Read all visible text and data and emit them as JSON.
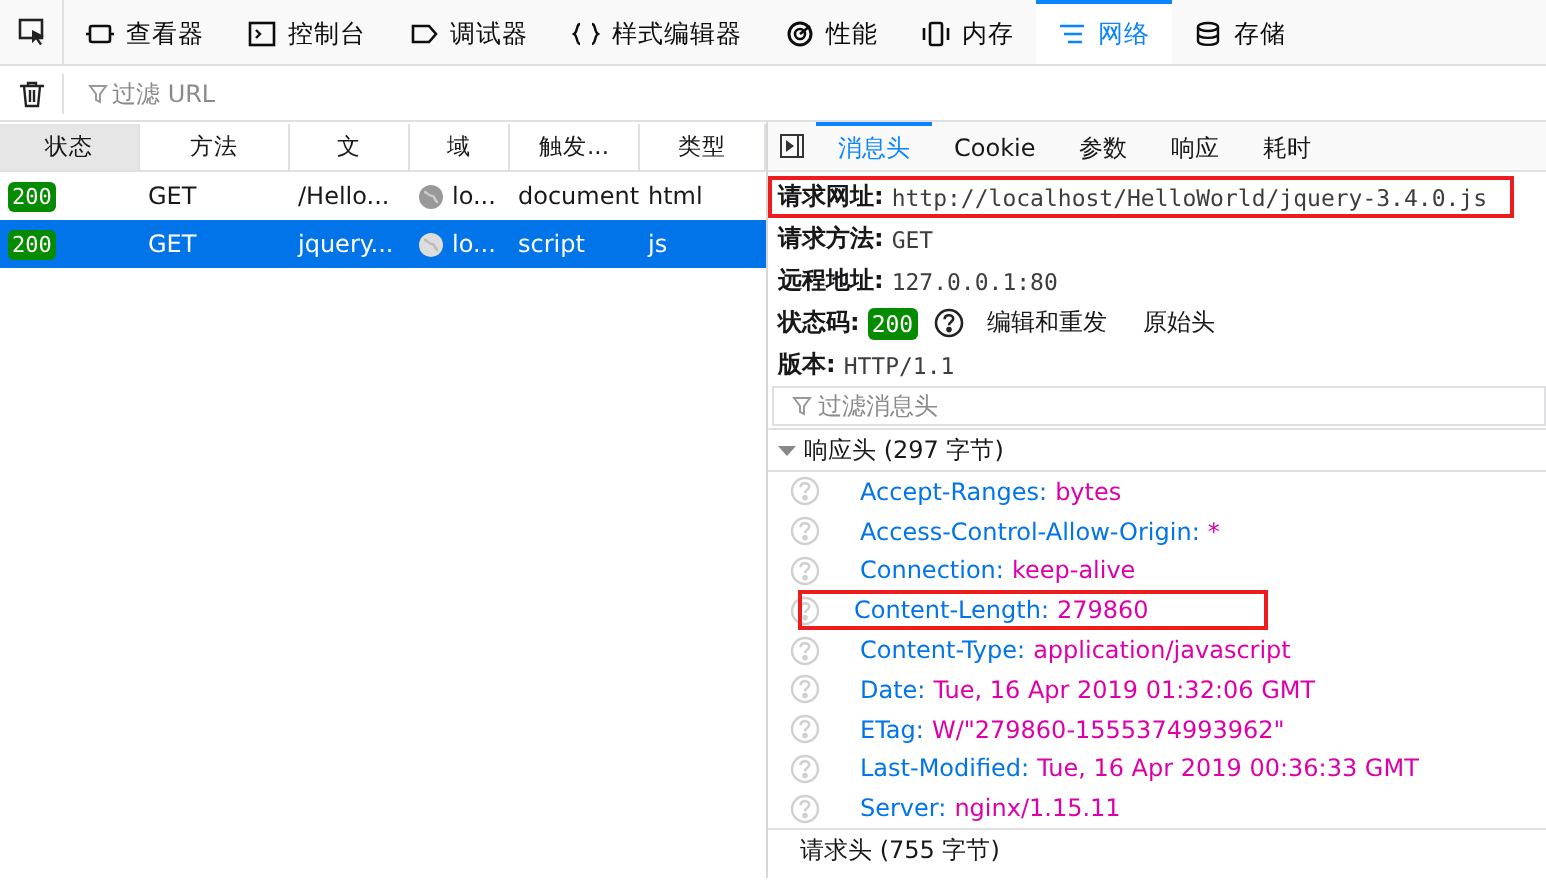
{
  "toolbar": {
    "tabs": [
      {
        "label": "查看器",
        "kind": "inspector",
        "selected": false
      },
      {
        "label": "控制台",
        "kind": "console",
        "selected": false
      },
      {
        "label": "调试器",
        "kind": "debugger",
        "selected": false
      },
      {
        "label": "样式编辑器",
        "kind": "style",
        "selected": false
      },
      {
        "label": "性能",
        "kind": "performance",
        "selected": false
      },
      {
        "label": "内存",
        "kind": "memory",
        "selected": false
      },
      {
        "label": "网络",
        "kind": "network",
        "selected": true
      },
      {
        "label": "存储",
        "kind": "storage",
        "selected": false
      }
    ]
  },
  "filter": {
    "placeholder": "过滤 URL"
  },
  "requests": {
    "columns": [
      {
        "label": "状态",
        "selected": true
      },
      {
        "label": "方法",
        "selected": false
      },
      {
        "label": "文",
        "selected": false
      },
      {
        "label": "域",
        "selected": false
      },
      {
        "label": "触发...",
        "selected": false
      },
      {
        "label": "类型",
        "selected": false
      }
    ],
    "rows": [
      {
        "status": "200",
        "method": "GET",
        "file": "/Hello...",
        "domain": "lo...",
        "cause": "document",
        "type": "html",
        "selected": false
      },
      {
        "status": "200",
        "method": "GET",
        "file": "jquery...",
        "domain": "lo...",
        "cause": "script",
        "type": "js",
        "selected": true
      }
    ]
  },
  "details": {
    "tabs": [
      {
        "label": "消息头",
        "selected": true
      },
      {
        "label": "Cookie",
        "selected": false
      },
      {
        "label": "参数",
        "selected": false
      },
      {
        "label": "响应",
        "selected": false
      },
      {
        "label": "耗时",
        "selected": false
      }
    ],
    "summary": [
      {
        "label": "请求网址:",
        "value": "http://localhost/HelloWorld/jquery-3.4.0.js",
        "highlighted": true
      },
      {
        "label": "请求方法:",
        "value": "GET",
        "highlighted": false
      },
      {
        "label": "远程地址:",
        "value": "127.0.0.1:80",
        "highlighted": false
      }
    ],
    "status": {
      "label": "状态码:",
      "badge": "200",
      "buttons": [
        "编辑和重发",
        "原始头"
      ]
    },
    "version": {
      "label": "版本:",
      "value": "HTTP/1.1"
    },
    "filter": {
      "placeholder": "过滤消息头"
    },
    "response_headers": {
      "title": "响应头 (297 字节)",
      "expanded": true,
      "headers": [
        {
          "name": "Accept-Ranges:",
          "value": "bytes",
          "highlighted": false
        },
        {
          "name": "Access-Control-Allow-Origin:",
          "value": "*",
          "highlighted": false
        },
        {
          "name": "Connection:",
          "value": "keep-alive",
          "highlighted": false
        },
        {
          "name": "Content-Length:",
          "value": "279860",
          "highlighted": true
        },
        {
          "name": "Content-Type:",
          "value": "application/javascript",
          "highlighted": false
        },
        {
          "name": "Date:",
          "value": "Tue, 16 Apr 2019 01:32:06 GMT",
          "highlighted": false
        },
        {
          "name": "ETag:",
          "value": "W/\"279860-1555374993962\"",
          "highlighted": false
        },
        {
          "name": "Last-Modified:",
          "value": "Tue, 16 Apr 2019 00:36:33 GMT",
          "highlighted": false
        },
        {
          "name": "Server:",
          "value": "nginx/1.15.11",
          "highlighted": false
        }
      ]
    },
    "request_headers": {
      "title": "请求头 (755 字节)"
    }
  }
}
